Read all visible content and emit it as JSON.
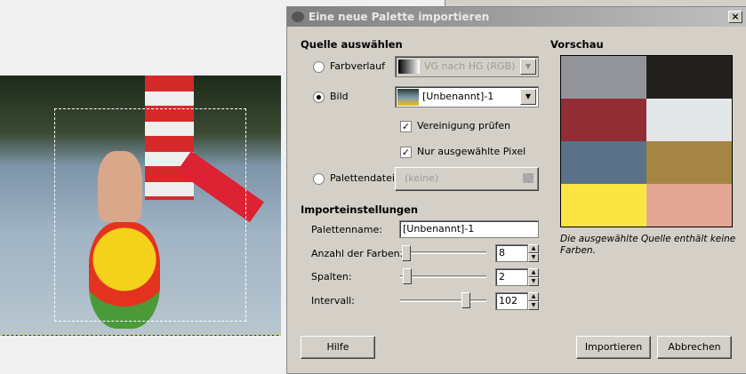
{
  "dialog": {
    "title": "Eine neue Palette importieren"
  },
  "source": {
    "heading": "Quelle auswählen",
    "gradient_label": "Farbverlauf",
    "gradient_value": "VG nach HG (RGB)",
    "image_label": "Bild",
    "image_value": "[Unbenannt]-1",
    "merge_label": "Vereinigung prüfen",
    "merge_checked": true,
    "selected_only_label": "Nur ausgewählte Pixel",
    "selected_only_checked": true,
    "file_label": "Palettendatei",
    "file_value": "(keine)",
    "selected": "Bild"
  },
  "settings": {
    "heading": "Importeinstellungen",
    "name_label": "Palettenname:",
    "name_value": "[Unbenannt]-1",
    "colors_label": "Anzahl der Farben:",
    "colors_value": "8",
    "columns_label": "Spalten:",
    "columns_value": "2",
    "interval_label": "Intervall:",
    "interval_value": "102"
  },
  "preview": {
    "heading": "Vorschau",
    "message": "Die ausgewählte Quelle enthält keine Farben.",
    "swatches": [
      "#93949a",
      "#22211e",
      "#922d36",
      "#e4e7e8",
      "#5a7289",
      "#a58543",
      "#fbe543",
      "#e4a795"
    ]
  },
  "buttons": {
    "help": "Hilfe",
    "import": "Importieren",
    "cancel": "Abbrechen",
    "close": "×"
  }
}
